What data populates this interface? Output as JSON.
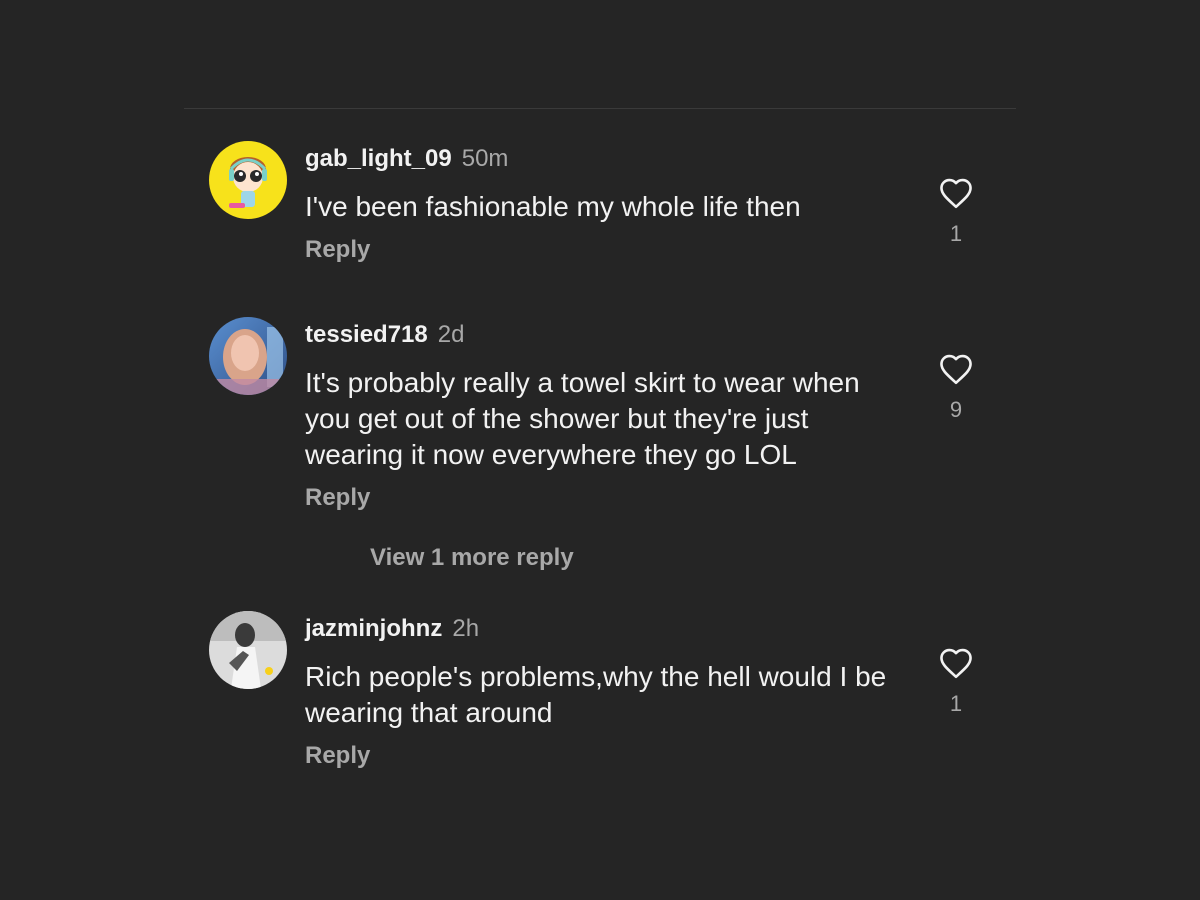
{
  "comments": [
    {
      "username": "gab_light_09",
      "time": "50m",
      "text": "I've been fashionable my whole life then",
      "reply_label": "Reply",
      "likes": "1",
      "avatar_icon": "cartoon-avatar"
    },
    {
      "username": "tessied718",
      "time": "2d",
      "text": "It's probably really a towel skirt to wear when you get out of the shower but they're just wearing it now everywhere they go LOL",
      "reply_label": "Reply",
      "likes": "9",
      "avatar_icon": "photo-avatar"
    },
    {
      "username": "jazminjohnz",
      "time": "2h",
      "text": "Rich people's problems,why the hell would I be wearing that around",
      "reply_label": "Reply",
      "likes": "1",
      "avatar_icon": "photo-avatar"
    }
  ],
  "view_more_replies": "View 1 more reply",
  "icons": {
    "like": "heart-outline-icon"
  },
  "colors": {
    "background": "#252525",
    "primary_text": "#f2f2f2",
    "secondary_text": "#a8a8a8",
    "avatar_1_bg": "#f7e21b"
  }
}
